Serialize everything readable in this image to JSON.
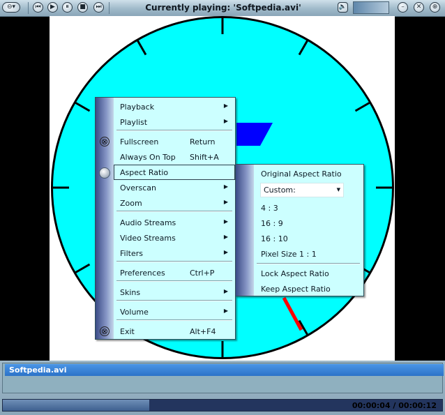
{
  "window": {
    "title": "Currently playing: 'Softpedia.avi'"
  },
  "toolbar": {
    "left_buttons": [
      "menu-icon",
      "previous-icon",
      "play-icon",
      "pause-icon",
      "stop-icon",
      "next-icon"
    ],
    "right_buttons": [
      "volume-icon",
      "minimize-icon",
      "close-icon",
      "maximize-icon"
    ]
  },
  "context_menu": {
    "items": [
      {
        "label": "Playback",
        "shortcut": "",
        "submenu": true
      },
      {
        "label": "Playlist",
        "shortcut": "",
        "submenu": true
      },
      {
        "label": "Fullscreen",
        "shortcut": "Return",
        "submenu": false,
        "icon": "fullscreen-icon"
      },
      {
        "label": "Always On Top",
        "shortcut": "Shift+A",
        "submenu": false
      },
      {
        "label": "Aspect Ratio",
        "shortcut": "",
        "submenu": false,
        "highlighted": true,
        "icon": "radio-icon"
      },
      {
        "label": "Overscan",
        "shortcut": "",
        "submenu": true
      },
      {
        "label": "Zoom",
        "shortcut": "",
        "submenu": true
      },
      {
        "label": "Audio Streams",
        "shortcut": "",
        "submenu": true
      },
      {
        "label": "Video Streams",
        "shortcut": "",
        "submenu": true
      },
      {
        "label": "Filters",
        "shortcut": "",
        "submenu": true
      },
      {
        "label": "Preferences",
        "shortcut": "Ctrl+P",
        "submenu": false
      },
      {
        "label": "Skins",
        "shortcut": "",
        "submenu": true
      },
      {
        "label": "Volume",
        "shortcut": "",
        "submenu": true
      },
      {
        "label": "Exit",
        "shortcut": "Alt+F4",
        "submenu": false,
        "icon": "exit-icon"
      }
    ]
  },
  "aspect_submenu": {
    "items": [
      {
        "label": "Original Aspect Ratio"
      },
      {
        "label": "Custom:",
        "type": "select"
      },
      {
        "label": "4 : 3"
      },
      {
        "label": "16 : 9"
      },
      {
        "label": "16 : 10"
      },
      {
        "label": "Pixel Size 1 : 1"
      },
      {
        "label": "Lock Aspect Ratio"
      },
      {
        "label": "Keep Aspect Ratio"
      }
    ]
  },
  "playlist": {
    "items": [
      "Softpedia.avi"
    ]
  },
  "seekbar": {
    "progress": 0.3333,
    "time": "00:00:04 / 00:00:12"
  },
  "volume": {
    "level": 1.0
  },
  "colors": {
    "menu_bg": "#ccffff",
    "clock_face": "#00ffff",
    "clock_hand_red": "#ff0000",
    "clock_hand_blue": "#0000ff",
    "playlist_selected": "#3a84dc"
  }
}
